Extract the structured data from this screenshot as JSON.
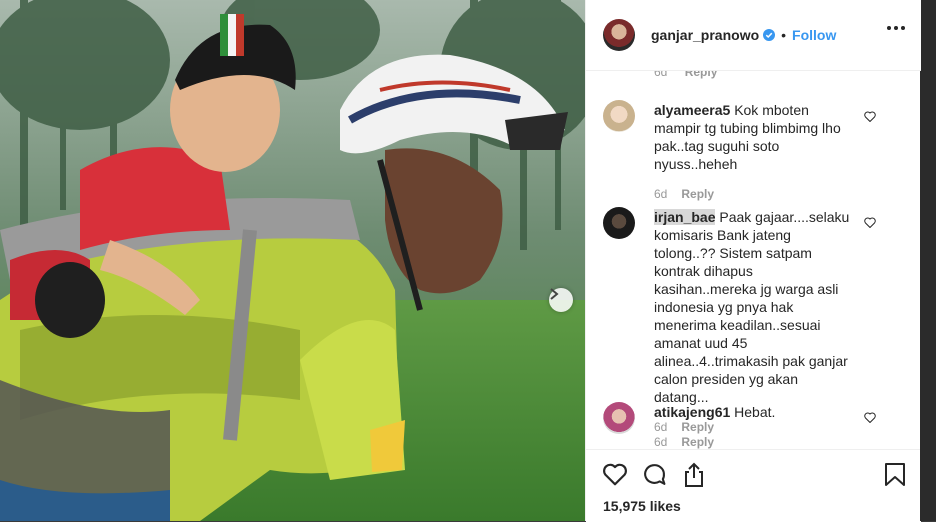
{
  "post": {
    "username": "ganjar_pranowo",
    "follow_label": "Follow",
    "likes": "15,975 likes"
  },
  "prev_comment": {
    "time": "6d",
    "reply": "Reply"
  },
  "comments": [
    {
      "user": "alyameera5",
      "text": "Kok mboten mampir tg tubing blimbimg lho pak..tag suguhi soto nyuss..heheh",
      "time": "6d",
      "reply": "Reply"
    },
    {
      "user": "irjan_bae",
      "text": "Paak gajaar....selaku komisaris Bank jateng tolong..?? Sistem satpam kontrak dihapus kasihan..mereka jg warga asli indonesia yg pnya hak menerima keadilan..sesuai amanat uud 45 alinea..4..trimakasih pak ganjar calon presiden yg akan datang...",
      "time": "6d",
      "reply": "Reply"
    },
    {
      "user": "atikajeng61",
      "text": "Hebat.",
      "time": "6d",
      "reply": "Reply"
    }
  ],
  "icons": {
    "verified": "verified-badge-icon",
    "more": "more-options-icon",
    "like": "heart-icon",
    "comment": "comment-bubble-icon",
    "share": "share-icon",
    "save": "bookmark-icon",
    "next": "chevron-right-icon"
  },
  "colors": {
    "link": "#3897f0",
    "text": "#262626",
    "muted": "#999999"
  }
}
